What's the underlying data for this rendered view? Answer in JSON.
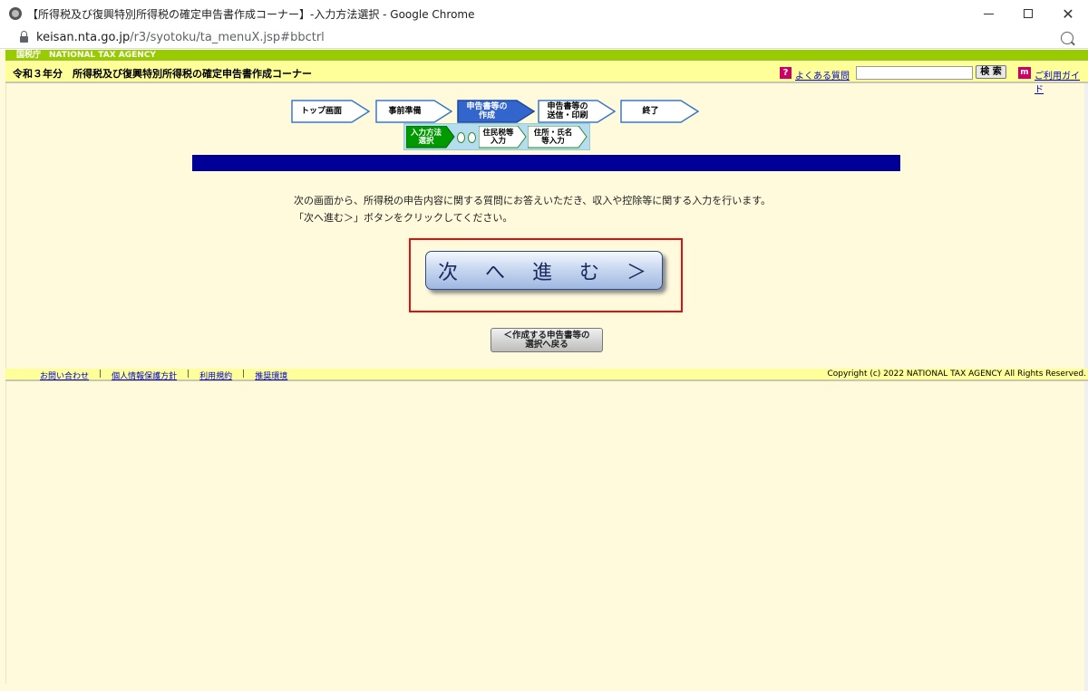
{
  "window": {
    "title": "【所得税及び復興特別所得税の確定申告書作成コーナー】-入力方法選択 - Google Chrome",
    "url_host": "keisan.nta.go.jp",
    "url_path": "/r3/syotoku/ta_menuX.jsp#bbctrl"
  },
  "header": {
    "agency": "国税庁　NATIONAL TAX AGENCY",
    "page_title": "令和３年分　所得税及び復興特別所得税の確定申告書作成コーナー",
    "faq_link": "よくある質問",
    "search_placeholder": "",
    "search_button": "検 索",
    "guide_link": "ご利用ガイド"
  },
  "steps": [
    {
      "label": "トップ画面"
    },
    {
      "label": "事前準備"
    },
    {
      "label": "申告書等の\n作成"
    },
    {
      "label": "申告書等の\n送信・印刷"
    },
    {
      "label": "終了"
    }
  ],
  "substeps": [
    {
      "label": "入力方法\n選択"
    },
    {
      "label": "住民税等\n入力"
    },
    {
      "label": "住所・氏名\n等入力"
    }
  ],
  "main": {
    "instruction_line1": "次の画面から、所得税の申告内容に関する質問にお答えいただき、収入や控除等に関する入力を行います。",
    "instruction_line2": "「次へ進む＞」ボタンをクリックしてください。",
    "next_button": "次　へ　進　む　＞",
    "back_button": "＜作成する申告書等の\n選択へ戻る"
  },
  "footer": {
    "links": [
      "お問い合わせ",
      "個人情報保護方針",
      "利用規約",
      "推奨環境"
    ],
    "copyright": "Copyright (c) 2022 NATIONAL TAX AGENCY All Rights Reserved."
  },
  "colors": {
    "nta_green": "#99cc00",
    "header_yellow": "#ffff99",
    "page_bg": "#fffadc",
    "step_active": "#3366cc",
    "substep_active": "#009900",
    "blue_bar": "#000099",
    "highlight_red": "#dd1111"
  }
}
